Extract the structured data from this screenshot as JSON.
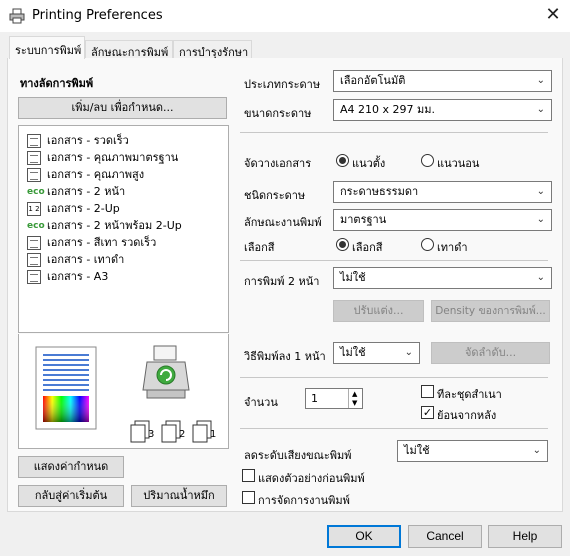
{
  "window": {
    "title": "Printing Preferences"
  },
  "tabs": [
    "ระบบการพิมพ์",
    "ลักษณะการพิมพ์",
    "การบำรุงรักษา"
  ],
  "left": {
    "presets_heading": "ทางลัดการพิมพ์",
    "add_remove_button": "เพิ่ม/ลบ เพื่อกำหนด...",
    "presets": [
      {
        "label": "เอกสาร - รวดเร็ว",
        "icon": "document-icon"
      },
      {
        "label": "เอกสาร - คุณภาพมาตรฐาน",
        "icon": "document-icon"
      },
      {
        "label": "เอกสาร - คุณภาพสูง",
        "icon": "document-icon"
      },
      {
        "label": "เอกสาร - 2 หน้า",
        "icon": "eco-icon"
      },
      {
        "label": "เอกสาร - 2-Up",
        "icon": "two-up-icon"
      },
      {
        "label": "เอกสาร - 2 หน้าพร้อม 2-Up",
        "icon": "eco-icon"
      },
      {
        "label": "เอกสาร - สีเทา รวดเร็ว",
        "icon": "document-icon"
      },
      {
        "label": "เอกสาร - เทาดำ",
        "icon": "document-icon"
      },
      {
        "label": "เอกสาร - A3",
        "icon": "document-icon"
      }
    ],
    "eco_text": "eco",
    "twoup_text": "1 2",
    "stack_numbers": [
      "3",
      "2",
      "1"
    ],
    "show_settings_button": "แสดงค่ากำหนด",
    "reset_defaults_button": "กลับสู่ค่าเริ่มต้น",
    "ink_levels_button": "ปริมาณน้ำหมึก"
  },
  "right": {
    "paper_source": {
      "label": "ประเภทกระดาษ",
      "value": "เลือกอัตโนมัติ"
    },
    "paper_size": {
      "label": "ขนาดกระดาษ",
      "value": "A4 210 x 297 มม."
    },
    "orientation": {
      "label": "จัดวางเอกสาร",
      "portrait": "แนวตั้ง",
      "landscape": "แนวนอน",
      "selected": "portrait"
    },
    "paper_type": {
      "label": "ชนิดกระดาษ",
      "value": "กระดาษธรรมดา"
    },
    "quality": {
      "label": "ลักษณะงานพิมพ์",
      "value": "มาตรฐาน"
    },
    "color": {
      "label": "เลือกสี",
      "color": "เลือกสี",
      "grayscale": "เทาดำ",
      "selected": "color"
    },
    "two_sided": {
      "label": "การพิมพ์ 2 หน้า",
      "value": "ไม่ใช้"
    },
    "settings_button": "ปรับแต่ง...",
    "density_button": "Density ของการพิมพ์...",
    "multipage": {
      "label": "วิธีพิมพ์ลง 1 หน้า",
      "value": "ไม่ใช้"
    },
    "order_button": "จัดลำดับ...",
    "copies": {
      "label": "จำนวน",
      "value": "1"
    },
    "collate": {
      "label": "ทีละชุดสำเนา",
      "checked": false
    },
    "reverse": {
      "label": "ย้อนจากหลัง",
      "checked": true
    },
    "quiet_mode": {
      "label": "ลดระดับเสียงขณะพิมพ์",
      "value": "ไม่ใช้"
    },
    "preview": {
      "label": "แสดงตัวอย่างก่อนพิมพ์",
      "checked": false
    },
    "job_arranger": {
      "label": "การจัดการงานพิมพ์",
      "checked": false
    }
  },
  "footer": {
    "ok": "OK",
    "cancel": "Cancel",
    "help": "Help"
  },
  "colors": {
    "accent": "#0078d7",
    "eco_green": "#3a9a3a"
  }
}
